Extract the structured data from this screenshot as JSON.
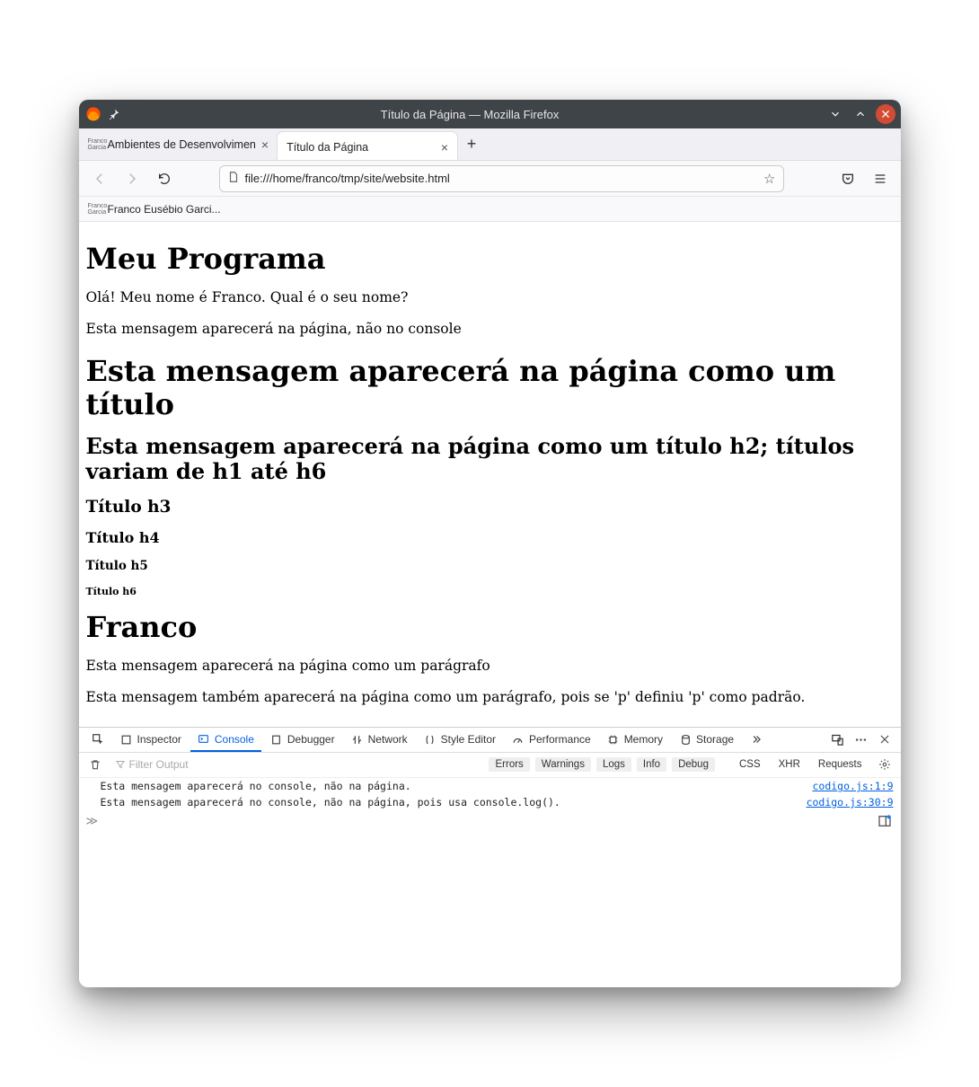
{
  "titlebar": {
    "title": "Título da Página — Mozilla Firefox"
  },
  "tabs": [
    {
      "label": "Ambientes de Desenvolvimen",
      "active": false
    },
    {
      "label": "Título da Página",
      "active": true
    }
  ],
  "urlbar": {
    "value": "file:///home/franco/tmp/site/website.html"
  },
  "bookmarks": [
    {
      "label": "Franco Eusébio Garci..."
    }
  ],
  "page": {
    "h1a": "Meu Programa",
    "p1": "Olá! Meu nome é Franco. Qual é o seu nome?",
    "p2": "Esta mensagem aparecerá na página, não no console",
    "h1b": "Esta mensagem aparecerá na página como um título",
    "h2": "Esta mensagem aparecerá na página como um título h2; títulos variam de h1 até h6",
    "h3": "Título h3",
    "h4": "Título h4",
    "h5": "Título h5",
    "h6": "Título h6",
    "h1c": "Franco",
    "p3": "Esta mensagem aparecerá na página como um parágrafo",
    "p4": "Esta mensagem também aparecerá na página como um parágrafo, pois se 'p' definiu 'p' como padrão."
  },
  "devtools": {
    "tabs": {
      "inspector": "Inspector",
      "console": "Console",
      "debugger": "Debugger",
      "network": "Network",
      "styleeditor": "Style Editor",
      "performance": "Performance",
      "memory": "Memory",
      "storage": "Storage"
    },
    "filter_placeholder": "Filter Output",
    "toggles": {
      "errors": "Errors",
      "warnings": "Warnings",
      "logs": "Logs",
      "info": "Info",
      "debug": "Debug",
      "css": "CSS",
      "xhr": "XHR",
      "requests": "Requests"
    },
    "lines": [
      {
        "msg": "Esta mensagem aparecerá no console, não na página.",
        "src": "codigo.js:1:9"
      },
      {
        "msg": "Esta mensagem aparecerá no console, não na página, pois usa console.log().",
        "src": "codigo.js:30:9"
      }
    ],
    "prompt": "≫"
  }
}
